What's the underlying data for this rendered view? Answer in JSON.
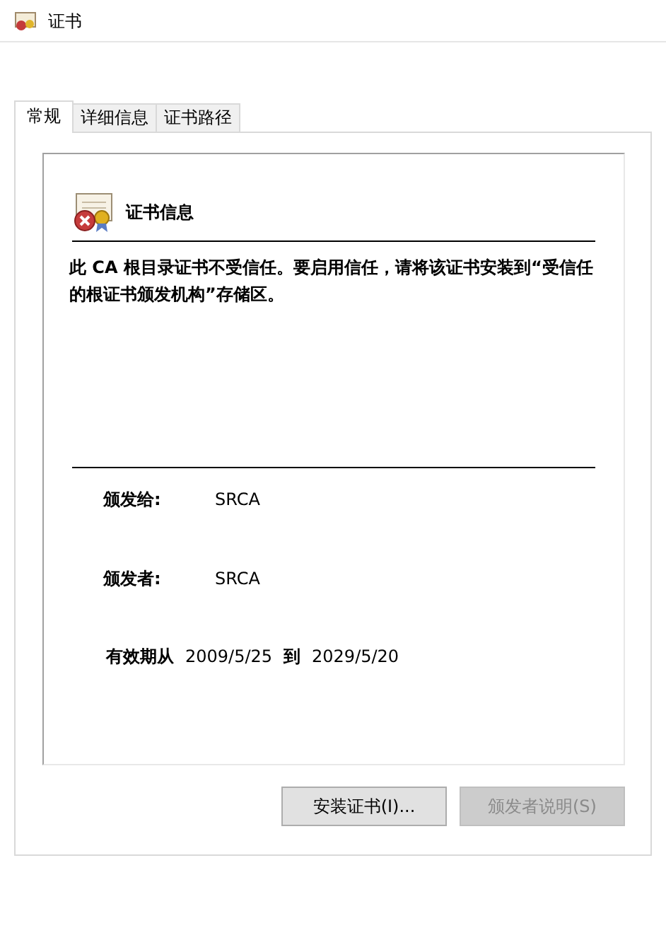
{
  "window": {
    "title": "证书"
  },
  "tabs": [
    {
      "label": "常规",
      "selected": true
    },
    {
      "label": "详细信息",
      "selected": false
    },
    {
      "label": "证书路径",
      "selected": false
    }
  ],
  "info": {
    "heading": "证书信息",
    "message": "此 CA 根目录证书不受信任。要启用信任，请将该证书安装到“受信任的根证书颁发机构”存储区。"
  },
  "fields": [
    {
      "label": "颁发给:",
      "value": "SRCA"
    },
    {
      "label": "颁发者:",
      "value": "SRCA"
    }
  ],
  "validity": {
    "label": "有效期从",
    "from": "2009/5/25",
    "separator": "到",
    "to": "2029/5/20"
  },
  "buttons": [
    {
      "label": "安装证书(I)...",
      "disabled": false
    },
    {
      "label": "颁发者说明(S)",
      "disabled": true
    }
  ]
}
